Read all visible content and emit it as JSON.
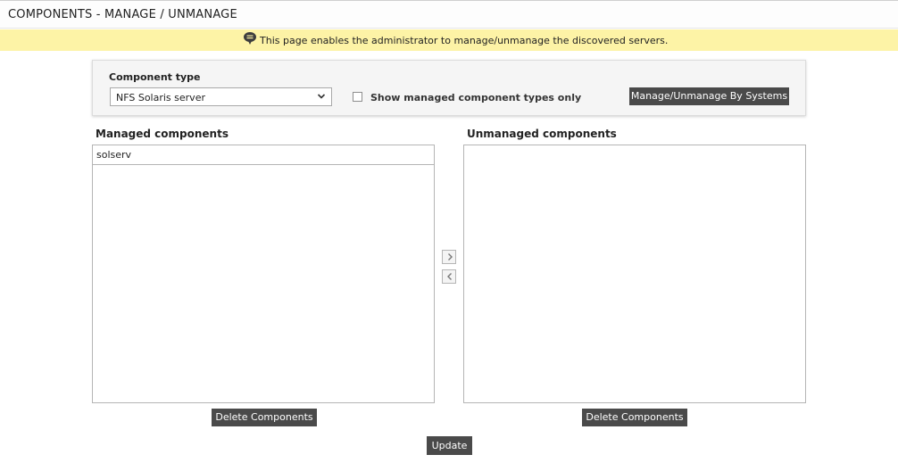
{
  "header": {
    "title": "COMPONENTS - MANAGE / UNMANAGE"
  },
  "info": {
    "icon": "speech-bubble-icon",
    "message": "This page enables the administrator to manage/unmanage the discovered servers."
  },
  "filter": {
    "component_type_label": "Component type",
    "component_type_value": "NFS Solaris server",
    "show_managed_label": "Show managed component types only",
    "show_managed_checked": false,
    "systems_button_label": "Manage/Unmanage By Systems"
  },
  "managed": {
    "title": "Managed components",
    "items": [
      "solserv"
    ],
    "delete_label": "Delete Components"
  },
  "unmanaged": {
    "title": "Unmanaged components",
    "items": [],
    "delete_label": "Delete Components"
  },
  "transfer": {
    "move_right_icon": "chevron-right-icon",
    "move_left_icon": "chevron-left-icon"
  },
  "actions": {
    "update_label": "Update"
  },
  "colors": {
    "info_bg": "#fdf3a6",
    "button_bg": "#4a4a4a"
  }
}
